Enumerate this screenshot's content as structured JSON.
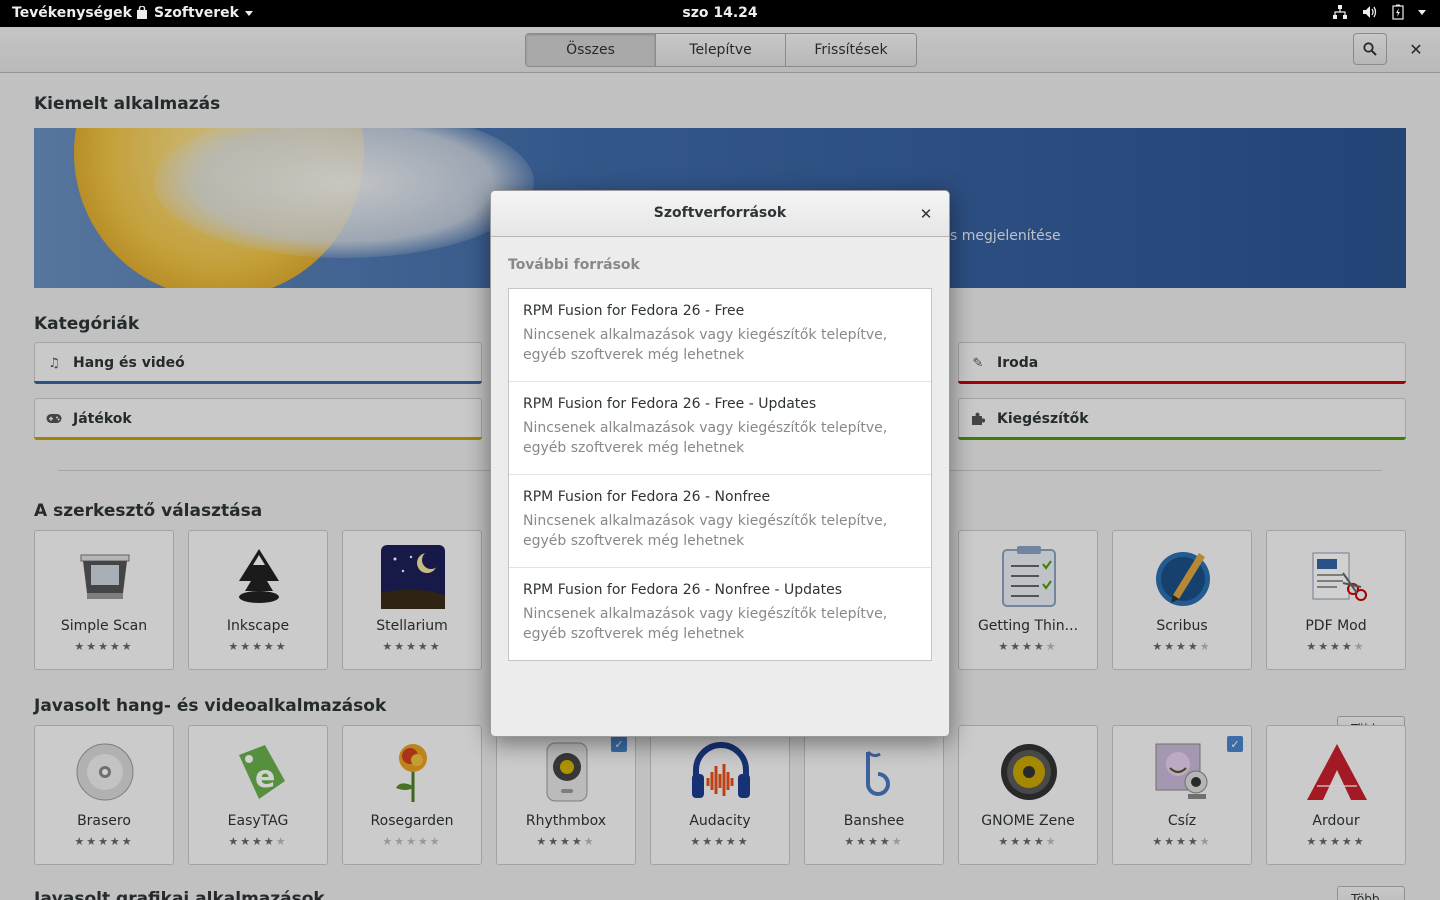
{
  "topbar": {
    "activities": "Tevékenységek",
    "app_name": "Szoftverek",
    "clock": "szo 14.24"
  },
  "header": {
    "tabs": [
      {
        "label": "Összes"
      },
      {
        "label": "Telepítve"
      },
      {
        "label": "Frissítések"
      }
    ],
    "active_tab": "Összes"
  },
  "featured": {
    "title": "Kiemelt alkalmazás",
    "banner_text": "zés megjelenítése"
  },
  "categories": {
    "title": "Kategóriák",
    "items": [
      {
        "label": "Hang és videó",
        "icon": "music-note-icon",
        "color": "#3465a4"
      },
      {
        "label": "Iroda",
        "icon": "edit-icon",
        "color": "#cc0000"
      },
      {
        "label": "Játékok",
        "icon": "gamepad-icon",
        "color": "#c4a000"
      },
      {
        "label": "Kiegészítők",
        "icon": "puzzle-icon",
        "color": "#4e9a06"
      }
    ]
  },
  "editors_choice": {
    "title": "A szerkesztő választása",
    "apps": [
      {
        "name": "Simple Scan",
        "rating": 5
      },
      {
        "name": "Inkscape",
        "rating": 5
      },
      {
        "name": "Stellarium",
        "rating": 5
      },
      {
        "name": "Getting Thin...",
        "rating": 4
      },
      {
        "name": "Scribus",
        "rating": 4
      },
      {
        "name": "PDF Mod",
        "rating": 4
      }
    ]
  },
  "audio_video": {
    "title": "Javasolt hang- és videoalkalmazások",
    "more_label": "Több...",
    "apps": [
      {
        "name": "Brasero",
        "rating": 5
      },
      {
        "name": "EasyTAG",
        "rating": 4
      },
      {
        "name": "Rosegarden",
        "rating": 0
      },
      {
        "name": "Rhythmbox",
        "rating": 4
      },
      {
        "name": "Audacity",
        "rating": 5
      },
      {
        "name": "Banshee",
        "rating": 4
      },
      {
        "name": "GNOME Zene",
        "rating": 4
      },
      {
        "name": "Csíz",
        "rating": 4
      },
      {
        "name": "Ardour",
        "rating": 5
      }
    ]
  },
  "graphics": {
    "title": "Javasolt grafikai alkalmazások",
    "more_label": "Több..."
  },
  "dialog": {
    "title": "Szoftverforrások",
    "section_title": "További források",
    "sources": [
      {
        "name": "RPM Fusion for Fedora 26 - Free",
        "desc": "Nincsenek alkalmazások vagy kiegészítők telepítve, egyéb szoftverek még lehetnek"
      },
      {
        "name": "RPM Fusion for Fedora 26 - Free - Updates",
        "desc": "Nincsenek alkalmazások vagy kiegészítők telepítve, egyéb szoftverek még lehetnek"
      },
      {
        "name": "RPM Fusion for Fedora 26 - Nonfree",
        "desc": "Nincsenek alkalmazások vagy kiegészítők telepítve, egyéb szoftverek még lehetnek"
      },
      {
        "name": "RPM Fusion for Fedora 26 - Nonfree - Updates",
        "desc": "Nincsenek alkalmazások vagy kiegészítők telepítve, egyéb szoftverek még lehetnek"
      }
    ]
  }
}
